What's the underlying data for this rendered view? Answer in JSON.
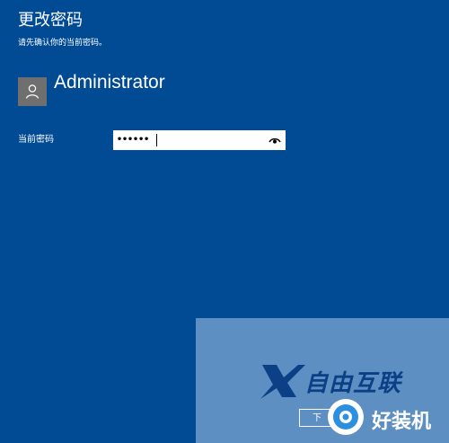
{
  "header": {
    "title": "更改密码",
    "subtitle": "请先确认你的当前密码。"
  },
  "account": {
    "username": "Administrator",
    "avatar_icon": "person-icon"
  },
  "password_field": {
    "label": "当前密码",
    "value": "••••••",
    "reveal_icon": "eye-icon"
  },
  "next_button": {
    "label": "下"
  },
  "watermark": {
    "brand": "自由互联",
    "badge": "好装机"
  },
  "colors": {
    "background": "#004b94",
    "overlay": "#96b9e1",
    "brand": "#0b3f86",
    "badge": "#2d8fe0"
  }
}
